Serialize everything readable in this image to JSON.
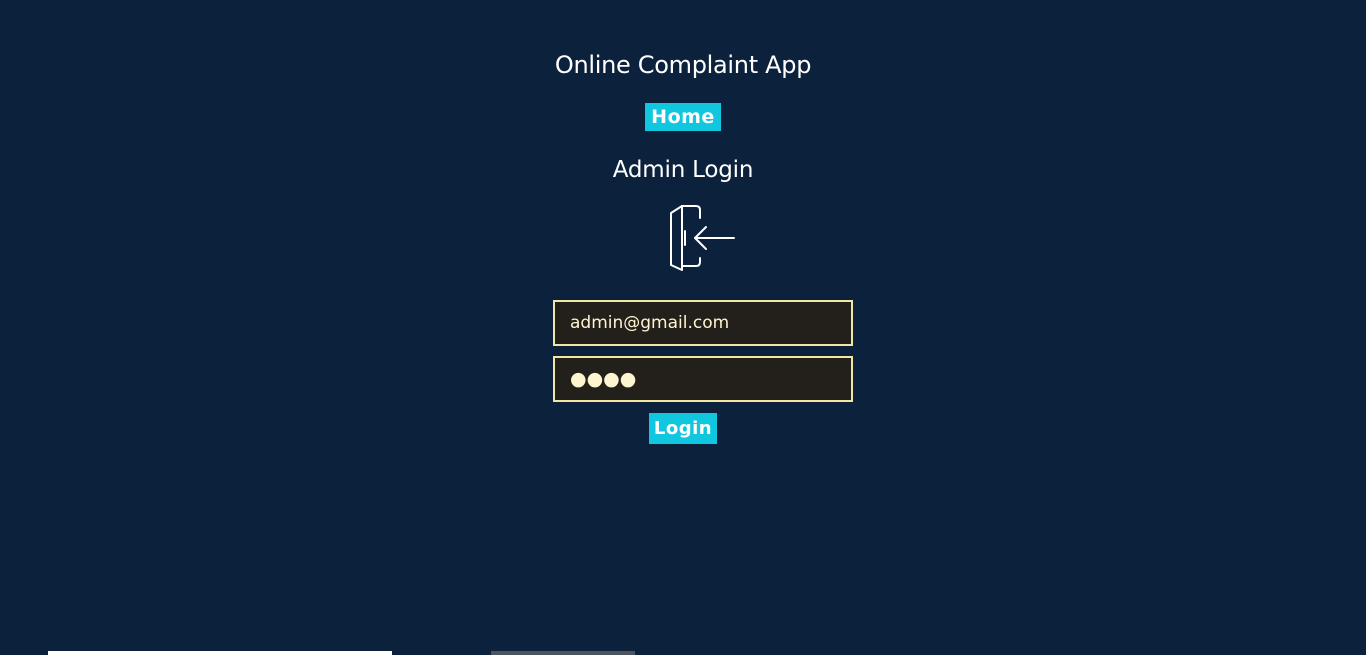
{
  "app": {
    "title": "Online Complaint App"
  },
  "nav": {
    "home_label": "Home"
  },
  "login": {
    "heading": "Admin Login",
    "icon": "door-enter-icon",
    "email_value": "admin@gmail.com",
    "password_mask": "●●●●",
    "submit_label": "Login"
  },
  "colors": {
    "background": "#0c223c",
    "accent": "#11c7e0",
    "field_background": "#231f1a",
    "field_border": "#f2e6a4"
  }
}
